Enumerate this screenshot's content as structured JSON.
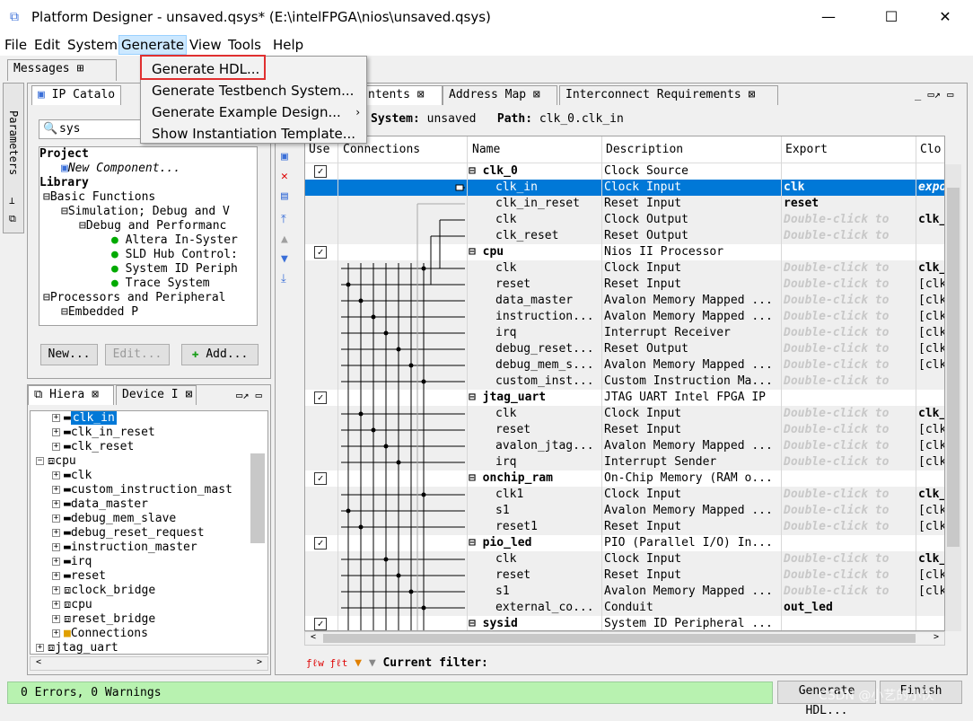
{
  "window": {
    "title": "Platform Designer - unsaved.qsys* (E:\\intelFPGA\\nios\\unsaved.qsys)"
  },
  "menubar": [
    "File",
    "Edit",
    "System",
    "Generate",
    "View",
    "Tools",
    "Help"
  ],
  "generate_menu": [
    "Generate HDL...",
    "Generate Testbench System...",
    "Generate Example Design...",
    "Show Instantiation Template..."
  ],
  "messages_tab": "Messages",
  "ip_catalog": {
    "tab": "IP Catalo",
    "search": "sys",
    "tree": [
      "Project",
      "New Component...",
      "Library",
      "Basic Functions",
      "Simulation; Debug and V",
      "Debug and Performanc",
      "Altera In-Syster",
      "SLD Hub Control:",
      "System ID Periph",
      "Trace System",
      "Processors and Peripheral",
      "Embedded P"
    ],
    "buttons": {
      "new": "New...",
      "edit": "Edit...",
      "add": "Add..."
    }
  },
  "side_tab": "Parameters",
  "hierarchy": {
    "tabs": [
      "Hiera",
      "Device I"
    ],
    "items": [
      "clk_in",
      "clk_in_reset",
      "clk_reset",
      "cpu",
      "clk",
      "custom_instruction_mast",
      "data_master",
      "debug_mem_slave",
      "debug_reset_request",
      "instruction_master",
      "irq",
      "reset",
      "clock_bridge",
      "cpu",
      "reset_bridge",
      "Connections",
      "jtag_uart"
    ]
  },
  "main": {
    "tabs": [
      "ntents",
      "Address Map",
      "Interconnect Requirements"
    ],
    "system_label": "System:",
    "system_value": "unsaved",
    "path_label": "Path:",
    "path_value": "clk_0.clk_in",
    "columns": [
      "Use",
      "Connections",
      "Name",
      "Description",
      "Export",
      "Clo"
    ],
    "rows": [
      {
        "name": "clk_0",
        "desc": "Clock Source",
        "export": "",
        "clk": "",
        "top": true
      },
      {
        "name": "clk_in",
        "desc": "Clock Input",
        "export": "clk",
        "clk": "expo",
        "sel": true
      },
      {
        "name": "clk_in_reset",
        "desc": "Reset Input",
        "export": "reset",
        "clk": ""
      },
      {
        "name": "clk",
        "desc": "Clock Output",
        "export": "Double-click to",
        "clk": "clk_"
      },
      {
        "name": "clk_reset",
        "desc": "Reset Output",
        "export": "Double-click to",
        "clk": ""
      },
      {
        "name": "cpu",
        "desc": "Nios II Processor",
        "export": "",
        "clk": "",
        "top": true
      },
      {
        "name": "clk",
        "desc": "Clock Input",
        "export": "Double-click to",
        "clk": "clk_"
      },
      {
        "name": "reset",
        "desc": "Reset Input",
        "export": "Double-click to",
        "clk": "[clk"
      },
      {
        "name": "data_master",
        "desc": "Avalon Memory Mapped ...",
        "export": "Double-click to",
        "clk": "[clk"
      },
      {
        "name": "instruction...",
        "desc": "Avalon Memory Mapped ...",
        "export": "Double-click to",
        "clk": "[clk"
      },
      {
        "name": "irq",
        "desc": "Interrupt Receiver",
        "export": "Double-click to",
        "clk": "[clk"
      },
      {
        "name": "debug_reset...",
        "desc": "Reset Output",
        "export": "Double-click to",
        "clk": "[clk"
      },
      {
        "name": "debug_mem_s...",
        "desc": "Avalon Memory Mapped ...",
        "export": "Double-click to",
        "clk": "[clk"
      },
      {
        "name": "custom_inst...",
        "desc": "Custom Instruction Ma...",
        "export": "Double-click to",
        "clk": ""
      },
      {
        "name": "jtag_uart",
        "desc": "JTAG UART Intel FPGA IP",
        "export": "",
        "clk": "",
        "top": true
      },
      {
        "name": "clk",
        "desc": "Clock Input",
        "export": "Double-click to",
        "clk": "clk_"
      },
      {
        "name": "reset",
        "desc": "Reset Input",
        "export": "Double-click to",
        "clk": "[clk"
      },
      {
        "name": "avalon_jtag...",
        "desc": "Avalon Memory Mapped ...",
        "export": "Double-click to",
        "clk": "[clk"
      },
      {
        "name": "irq",
        "desc": "Interrupt Sender",
        "export": "Double-click to",
        "clk": "[clk"
      },
      {
        "name": "onchip_ram",
        "desc": "On-Chip Memory (RAM o...",
        "export": "",
        "clk": "",
        "top": true
      },
      {
        "name": "clk1",
        "desc": "Clock Input",
        "export": "Double-click to",
        "clk": "clk_"
      },
      {
        "name": "s1",
        "desc": "Avalon Memory Mapped ...",
        "export": "Double-click to",
        "clk": "[clk"
      },
      {
        "name": "reset1",
        "desc": "Reset Input",
        "export": "Double-click to",
        "clk": "[clk"
      },
      {
        "name": "pio_led",
        "desc": "PIO (Parallel I/O) In...",
        "export": "",
        "clk": "",
        "top": true
      },
      {
        "name": "clk",
        "desc": "Clock Input",
        "export": "Double-click to",
        "clk": "clk_"
      },
      {
        "name": "reset",
        "desc": "Reset Input",
        "export": "Double-click to",
        "clk": "[clk"
      },
      {
        "name": "s1",
        "desc": "Avalon Memory Mapped ...",
        "export": "Double-click to",
        "clk": "[clk"
      },
      {
        "name": "external_co...",
        "desc": "Conduit",
        "export": "out_led",
        "clk": ""
      },
      {
        "name": "sysid",
        "desc": "System ID Peripheral ...",
        "export": "",
        "clk": "",
        "top": true
      }
    ],
    "filter_label": "Current filter:"
  },
  "status": {
    "text": "0 Errors, 0 Warnings"
  },
  "bottom_buttons": {
    "generate": "Generate HDL...",
    "finish": "Finish"
  },
  "watermark": "CSDN @小艺的小伙"
}
